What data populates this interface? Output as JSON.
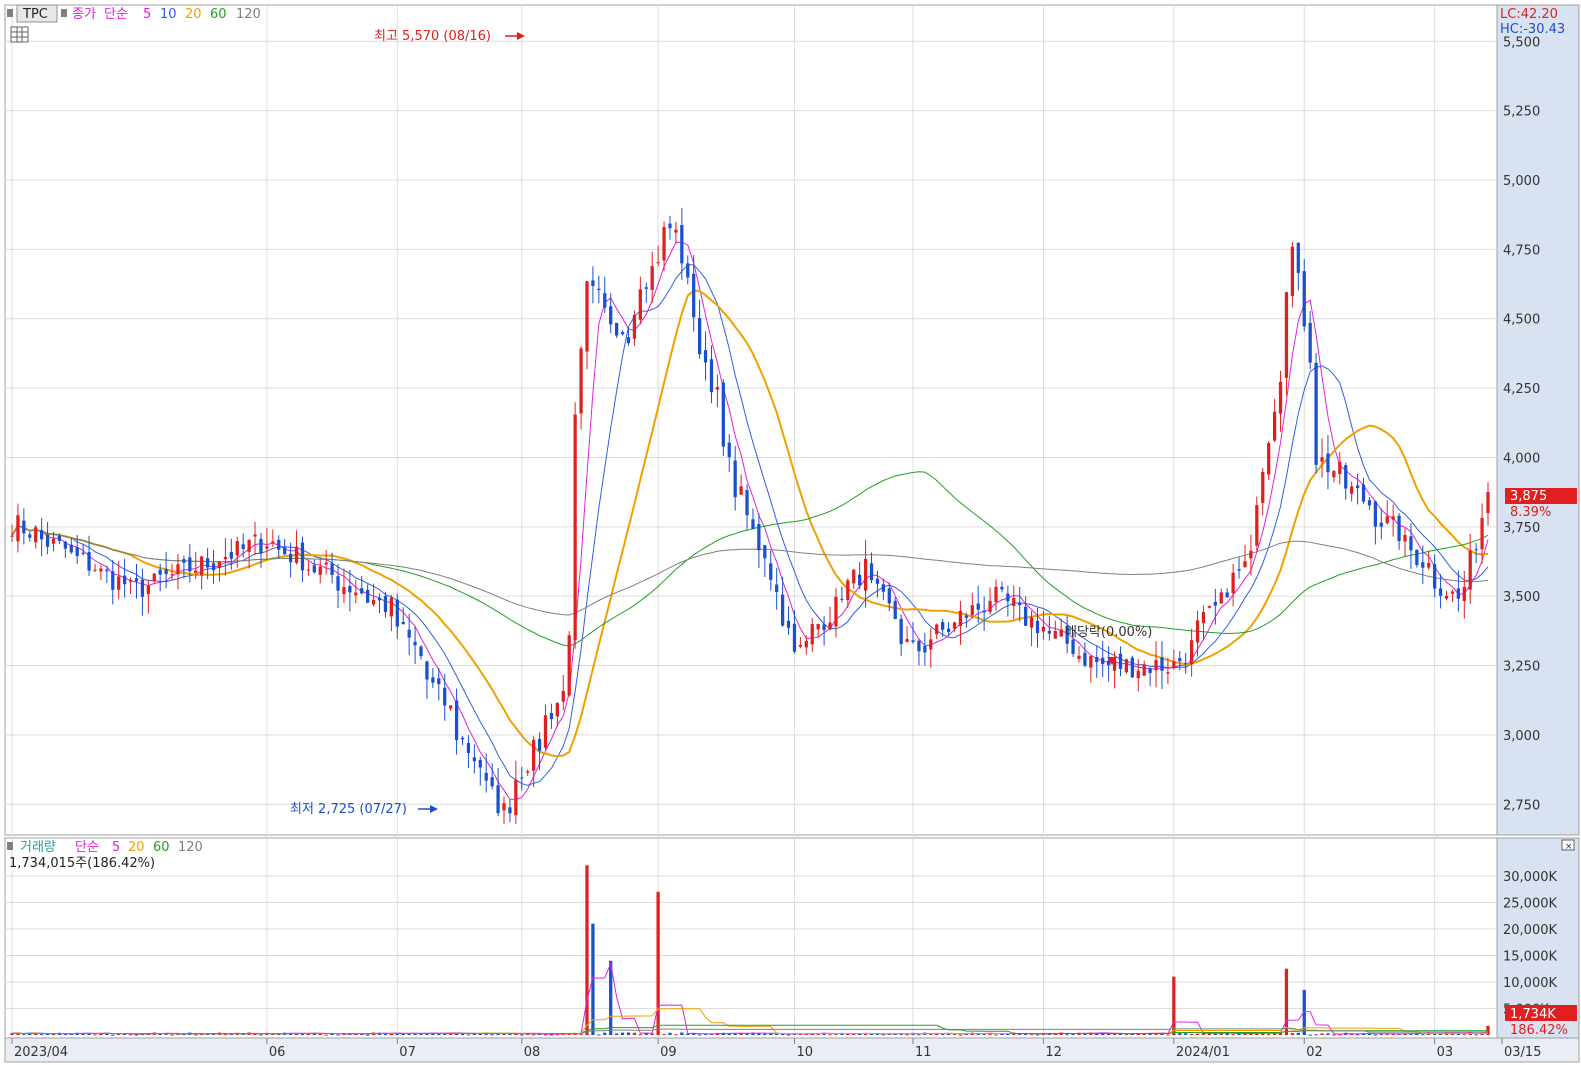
{
  "legend_price": {
    "symbol": "TPC",
    "close_label": "종가",
    "ma_type": "단순",
    "ma_periods": [
      "5",
      "10",
      "20",
      "60",
      "120"
    ],
    "ma_colors": [
      "#e020e0",
      "#3060e0",
      "#f0a000",
      "#20a020",
      "#808080"
    ]
  },
  "legend_volume": {
    "label": "거래량",
    "ma_type": "단순",
    "ma_periods": [
      "5",
      "20",
      "60",
      "120"
    ],
    "ma_colors": [
      "#e020e0",
      "#f0a000",
      "#20a020",
      "#808080"
    ],
    "current": "1,734,015주(186.42%)"
  },
  "corner": {
    "lc": "LC:42.20",
    "hc": "HC:-30.43"
  },
  "price_axis": {
    "ticks": [
      "5,500",
      "5,250",
      "5,000",
      "4,750",
      "4,500",
      "4,250",
      "4,000",
      "3,750",
      "3,500",
      "3,250",
      "3,000",
      "2,750"
    ],
    "current_price": "3,875",
    "current_change": "8.39%"
  },
  "volume_axis": {
    "ticks": [
      "30,000K",
      "25,000K",
      "20,000K",
      "15,000K",
      "10,000K",
      "5,000K"
    ],
    "current_volume": "1,734K",
    "current_pct": "186.42%"
  },
  "x_axis": {
    "labels": [
      "2023/04",
      "06",
      "07",
      "08",
      "09",
      "10",
      "11",
      "12",
      "2024/01",
      "02",
      "03",
      "03/15"
    ]
  },
  "annotations": {
    "high": "최고 5,570 (08/16)",
    "low": "최저 2,725 (07/27)",
    "dividend": "배당락(0.00%)"
  },
  "colors": {
    "up": "#e02020",
    "down": "#1a50d0",
    "axis_bg": "#d8e2f0",
    "grid": "#dcdcdc"
  },
  "chart_data": {
    "type": "candlestick",
    "x_range": [
      "2023/04",
      "03/15"
    ],
    "price_ylim": [
      2650,
      5620
    ],
    "volume_ylim": [
      0,
      33000
    ],
    "volume_unit": "K",
    "grid": true,
    "price_anchors": [
      {
        "date": "2023/04",
        "price": 3780
      },
      {
        "date": "2023/05",
        "price": 3520
      },
      {
        "date": "2023/06",
        "price": 3700
      },
      {
        "date": "2023/07",
        "price": 3450
      },
      {
        "date": "2023/07/27",
        "price": 2725
      },
      {
        "date": "2023/08/10",
        "price": 3150
      },
      {
        "date": "2023/08/16",
        "price": 4600
      },
      {
        "date": "2023/08/25",
        "price": 4450
      },
      {
        "date": "2023/09/05",
        "price": 4850
      },
      {
        "date": "2023/09/20",
        "price": 3900
      },
      {
        "date": "2023/10/05",
        "price": 3300
      },
      {
        "date": "2023/10/20",
        "price": 3600
      },
      {
        "date": "2023/11/01",
        "price": 3300
      },
      {
        "date": "2023/11/20",
        "price": 3500
      },
      {
        "date": "2023/12/15",
        "price": 3250
      },
      {
        "date": "2024/01/02",
        "price": 3250
      },
      {
        "date": "2024/01/20",
        "price": 3650
      },
      {
        "date": "2024/01/30",
        "price": 4750
      },
      {
        "date": "2024/02/05",
        "price": 4000
      },
      {
        "date": "2024/02/25",
        "price": 3700
      },
      {
        "date": "2024/03/10",
        "price": 3450
      },
      {
        "date": "2024/03/15",
        "price": 3875
      }
    ],
    "volume_spikes": [
      {
        "date": "2023/08/16",
        "volume": 32000
      },
      {
        "date": "2023/08/17",
        "volume": 21000
      },
      {
        "date": "2023/08/22",
        "volume": 14000
      },
      {
        "date": "2023/09/01",
        "volume": 27000
      },
      {
        "date": "2024/01/02",
        "volume": 11000
      },
      {
        "date": "2024/01/29",
        "volume": 12500
      },
      {
        "date": "2024/02/01",
        "volume": 8500
      },
      {
        "date": "2024/03/15",
        "volume": 1734
      }
    ]
  }
}
